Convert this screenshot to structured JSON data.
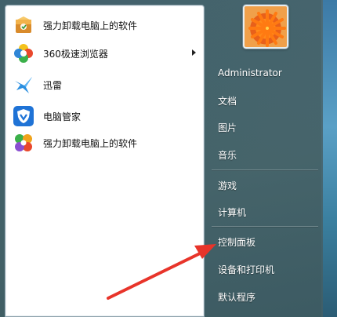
{
  "start_menu": {
    "programs": [
      {
        "label": "强力卸载电脑上的软件",
        "icon": "uninstaller-box-icon",
        "has_submenu": false
      },
      {
        "label": "360极速浏览器",
        "icon": "360-browser-icon",
        "has_submenu": true
      },
      {
        "label": "迅雷",
        "icon": "xunlei-bird-icon",
        "has_submenu": false
      },
      {
        "label": "电脑管家",
        "icon": "pc-manager-shield-icon",
        "has_submenu": false
      },
      {
        "label": "强力卸载电脑上的软件",
        "icon": "uninstaller-flower-icon",
        "has_submenu": false
      }
    ],
    "right": {
      "user_name": "Administrator",
      "items": [
        "文档",
        "图片",
        "音乐",
        "游戏",
        "计算机",
        "控制面板",
        "设备和打印机",
        "默认程序"
      ]
    },
    "annotation": {
      "color": "#e8342a",
      "target": "控制面板"
    }
  }
}
